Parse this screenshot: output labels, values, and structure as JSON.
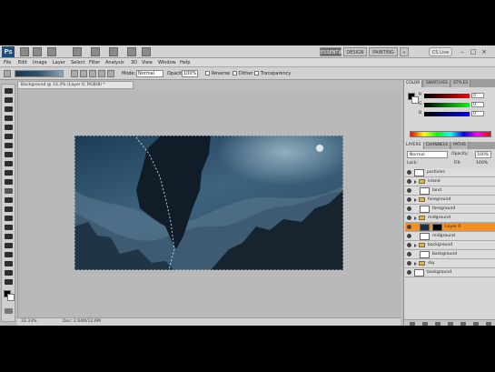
{
  "workspace": {
    "buttons": [
      {
        "label": "ESSENTIALS",
        "active": true
      },
      {
        "label": "DESIGN",
        "active": false
      },
      {
        "label": "PAINTING",
        "active": false
      }
    ],
    "switcher_label": "»",
    "cs_live": "CS Live"
  },
  "app_icon": "Ps",
  "menu": [
    "File",
    "Edit",
    "Image",
    "Layer",
    "Select",
    "Filter",
    "Analysis",
    "3D",
    "View",
    "Window",
    "Help"
  ],
  "options_bar": {
    "mode_label": "Mode:",
    "mode_value": "Normal",
    "opacity_label": "Opacity:",
    "opacity_value": "100%",
    "reverse_label": "Reverse",
    "dither_label": "Dither",
    "transparency_label": "Transparency"
  },
  "document": {
    "tab_title": "Background @ 33.3% (Layer 0, RGB/8) *",
    "status_zoom": "33.33%",
    "status_doc": "Doc: 2.64M/12.6M"
  },
  "color_panel": {
    "tabs": [
      "COLOR",
      "SWATCHES",
      "STYLES"
    ],
    "channels": [
      {
        "label": "R",
        "value": "0"
      },
      {
        "label": "G",
        "value": "0"
      },
      {
        "label": "B",
        "value": "0"
      }
    ]
  },
  "layers_panel": {
    "tabs": [
      "LAYERS",
      "CHANNELS",
      "PATHS"
    ],
    "blend_mode": "Normal",
    "opacity_label": "Opacity:",
    "opacity_value": "100%",
    "lock_label": "Lock:",
    "fill_label": "Fill:",
    "fill_value": "100%",
    "layers": [
      {
        "name": "particles",
        "type": "layer",
        "indent": 0,
        "thumb": "light"
      },
      {
        "name": "island",
        "type": "group",
        "indent": 0
      },
      {
        "name": "land",
        "type": "layer",
        "indent": 1,
        "thumb": "light"
      },
      {
        "name": "foreground",
        "type": "group",
        "indent": 0
      },
      {
        "name": "foreground",
        "type": "layer",
        "indent": 1,
        "thumb": "light"
      },
      {
        "name": "midground",
        "type": "group",
        "indent": 0
      },
      {
        "name": "Layer 0",
        "type": "layer",
        "indent": 1,
        "thumb": "dark",
        "selected": true
      },
      {
        "name": "midground",
        "type": "layer",
        "indent": 1,
        "thumb": "light"
      },
      {
        "name": "background",
        "type": "group",
        "indent": 0
      },
      {
        "name": "background",
        "type": "layer",
        "indent": 1,
        "thumb": "light"
      },
      {
        "name": "sky",
        "type": "group",
        "indent": 0
      },
      {
        "name": "background",
        "type": "layer",
        "indent": 0,
        "thumb": "light"
      }
    ]
  },
  "colors": {
    "selected_layer": "#f5901e",
    "sky_top": "#2f5570",
    "sky_bottom": "#1c3447"
  }
}
